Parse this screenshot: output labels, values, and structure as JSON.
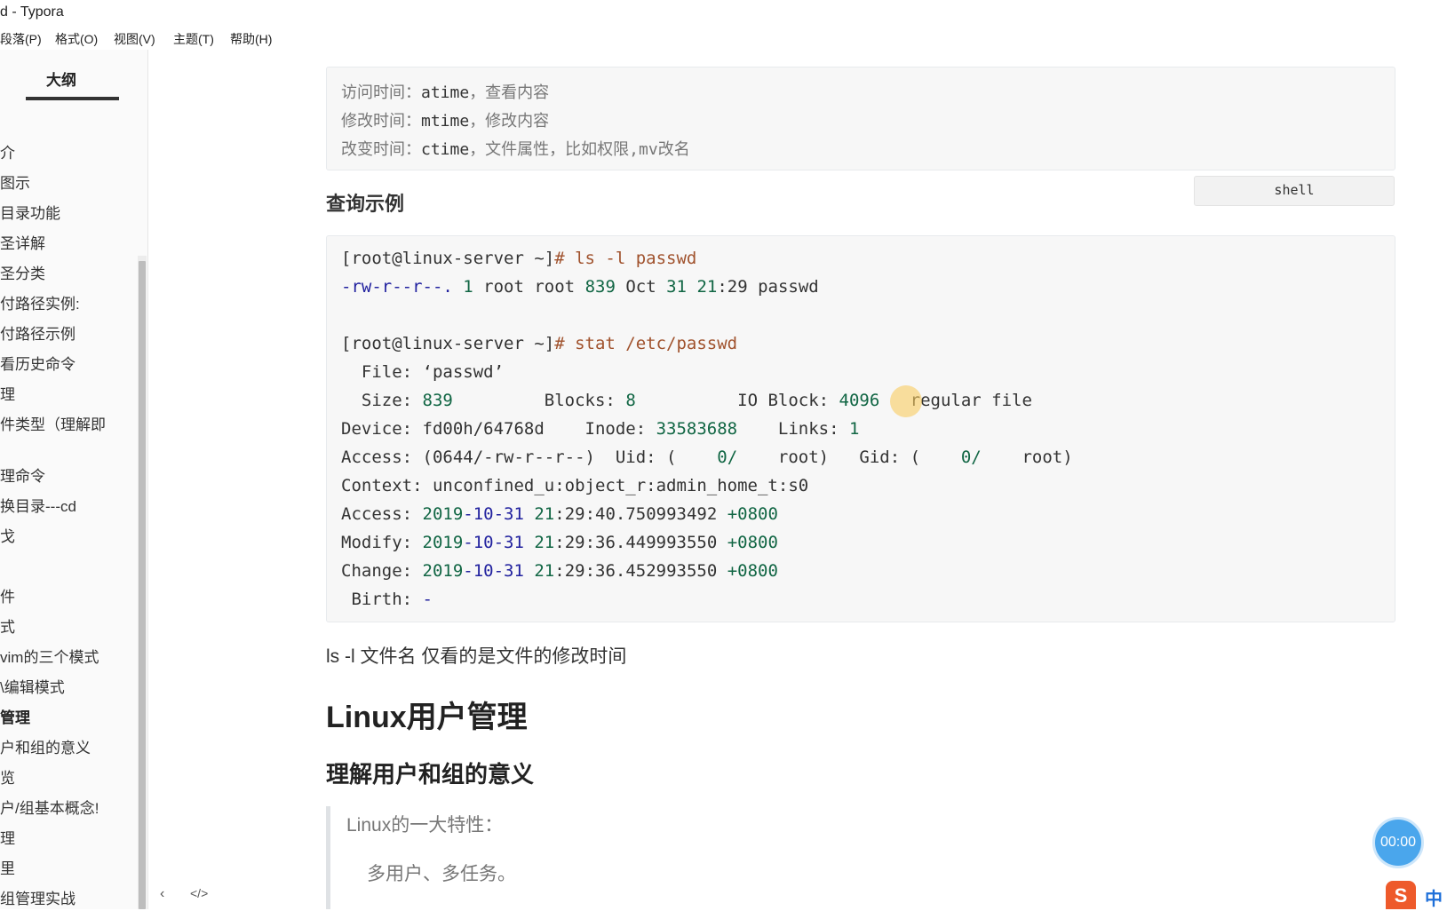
{
  "window": {
    "title": "d - Typora"
  },
  "menu": [
    "段落(P)",
    "格式(O)",
    "视图(V)",
    "主题(T)",
    "帮助(H)"
  ],
  "sidebar": {
    "tab": "大纲",
    "items": [
      {
        "label": "介",
        "bold": false
      },
      {
        "label": "图示",
        "bold": false
      },
      {
        "label": "目录功能",
        "bold": false
      },
      {
        "label": "圣详解",
        "bold": false
      },
      {
        "label": "圣分类",
        "bold": false
      },
      {
        "label": "付路径实例:",
        "bold": false
      },
      {
        "label": "付路径示例",
        "bold": false
      },
      {
        "label": "看历史命令",
        "bold": false
      },
      {
        "label": "理",
        "bold": false
      },
      {
        "label": "件类型（理解即",
        "bold": false
      },
      {
        "label": "理命令",
        "bold": false
      },
      {
        "label": "换目录---cd",
        "bold": false
      },
      {
        "label": "戈",
        "bold": false
      },
      {
        "label": "件",
        "bold": false
      },
      {
        "label": "式",
        "bold": false
      },
      {
        "label": "vim的三个模式",
        "bold": false
      },
      {
        "label": "\\编辑模式",
        "bold": false
      },
      {
        "label": "管理",
        "bold": true
      },
      {
        "label": "户和组的意义",
        "bold": false
      },
      {
        "label": "览",
        "bold": false
      },
      {
        "label": "户/组基本概念!",
        "bold": false
      },
      {
        "label": "理",
        "bold": false
      },
      {
        "label": "里",
        "bold": false
      },
      {
        "label": "组管理实战",
        "bold": false
      }
    ],
    "bottom_left": "‹",
    "bottom_code": "</>"
  },
  "code_block_1": {
    "lines": [
      {
        "pre": "访问时间：",
        "kw": "atime",
        "post": "，查看内容"
      },
      {
        "pre": "修改时间：",
        "kw": "mtime",
        "post": "，修改内容"
      },
      {
        "pre": "改变时间：",
        "kw": "ctime",
        "post": "，文件属性，比如权限,mv改名"
      }
    ]
  },
  "lang_label": "shell",
  "heading_query": "查询示例",
  "code_block_2": {
    "l1_prompt": "[root@linux-server ~]",
    "l1_cmd": "# ls -l passwd",
    "l2_a": "-rw-r--r--.",
    "l2_b": " 1",
    "l2_c": " root root ",
    "l2_d": "839",
    "l2_e": " Oct ",
    "l2_f": "31",
    "l2_g": " ",
    "l2_h": "21",
    "l2_i": ":29 passwd",
    "l3_prompt": "[root@linux-server ~]",
    "l3_cmd": "# stat /etc/passwd",
    "l4": "  File: ‘passwd’",
    "l5_a": "  Size: ",
    "l5_b": "839",
    "l5_c": "         Blocks: ",
    "l5_d": "8",
    "l5_e": "          IO Block: ",
    "l5_f": "4096",
    "l5_g": "   regular file",
    "l6_a": "Device: fd00h/64768d    Inode: ",
    "l6_b": "33583688",
    "l6_c": "    Links: ",
    "l6_d": "1",
    "l7_a": "Access: (0644/-rw-r--r--)  Uid: (    ",
    "l7_b": "0/",
    "l7_c": "    root)   Gid: (    ",
    "l7_d": "0/",
    "l7_e": "    root)",
    "l8": "Context: unconfined_u:object_r:admin_home_t:s0",
    "times": [
      {
        "label": "Access: ",
        "year": "2019",
        "md": "-10-31",
        "hh": " 21",
        "rest": ":29:40.750993492 ",
        "tz": "+0800"
      },
      {
        "label": "Modify: ",
        "year": "2019",
        "md": "-10-31",
        "hh": " 21",
        "rest": ":29:36.449993550 ",
        "tz": "+0800"
      },
      {
        "label": "Change: ",
        "year": "2019",
        "md": "-10-31",
        "hh": " 21",
        "rest": ":29:36.452993550 ",
        "tz": "+0800"
      }
    ],
    "l12_a": " Birth: ",
    "l12_b": "-"
  },
  "paragraph": "ls -l 文件名 仅看的是文件的修改时间",
  "heading_linux": "Linux用户管理",
  "heading_understand": "理解用户和组的意义",
  "quote": {
    "line1": "Linux的一大特性：",
    "line2": "多用户、多任务。"
  },
  "timer": "00:00",
  "ime": {
    "logo": "S",
    "mode": "中"
  }
}
